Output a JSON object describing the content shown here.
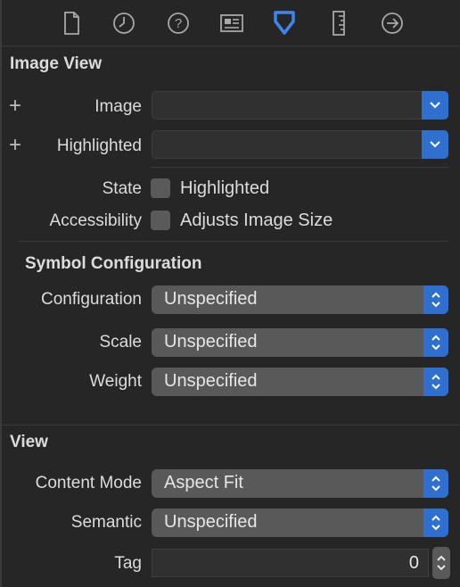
{
  "toolbar": {
    "icons": [
      "file-inspector-icon",
      "history-icon",
      "quick-help-icon",
      "identity-inspector-icon",
      "attributes-inspector-icon",
      "size-inspector-icon",
      "connections-inspector-icon"
    ],
    "selected_index": 4,
    "accent": "#3d86f0"
  },
  "image_view": {
    "title": "Image View",
    "image_label": "Image",
    "image_value": "",
    "highlighted_label": "Highlighted",
    "highlighted_value": "",
    "state_label": "State",
    "state_checkbox_label": "Highlighted",
    "state_checked": false,
    "accessibility_label": "Accessibility",
    "accessibility_checkbox_label": "Adjusts Image Size",
    "accessibility_checked": false
  },
  "symbol_configuration": {
    "title": "Symbol Configuration",
    "configuration_label": "Configuration",
    "configuration_value": "Unspecified",
    "scale_label": "Scale",
    "scale_value": "Unspecified",
    "weight_label": "Weight",
    "weight_value": "Unspecified"
  },
  "view": {
    "title": "View",
    "content_mode_label": "Content Mode",
    "content_mode_value": "Aspect Fit",
    "semantic_label": "Semantic",
    "semantic_value": "Unspecified",
    "tag_label": "Tag",
    "tag_value": "0"
  }
}
